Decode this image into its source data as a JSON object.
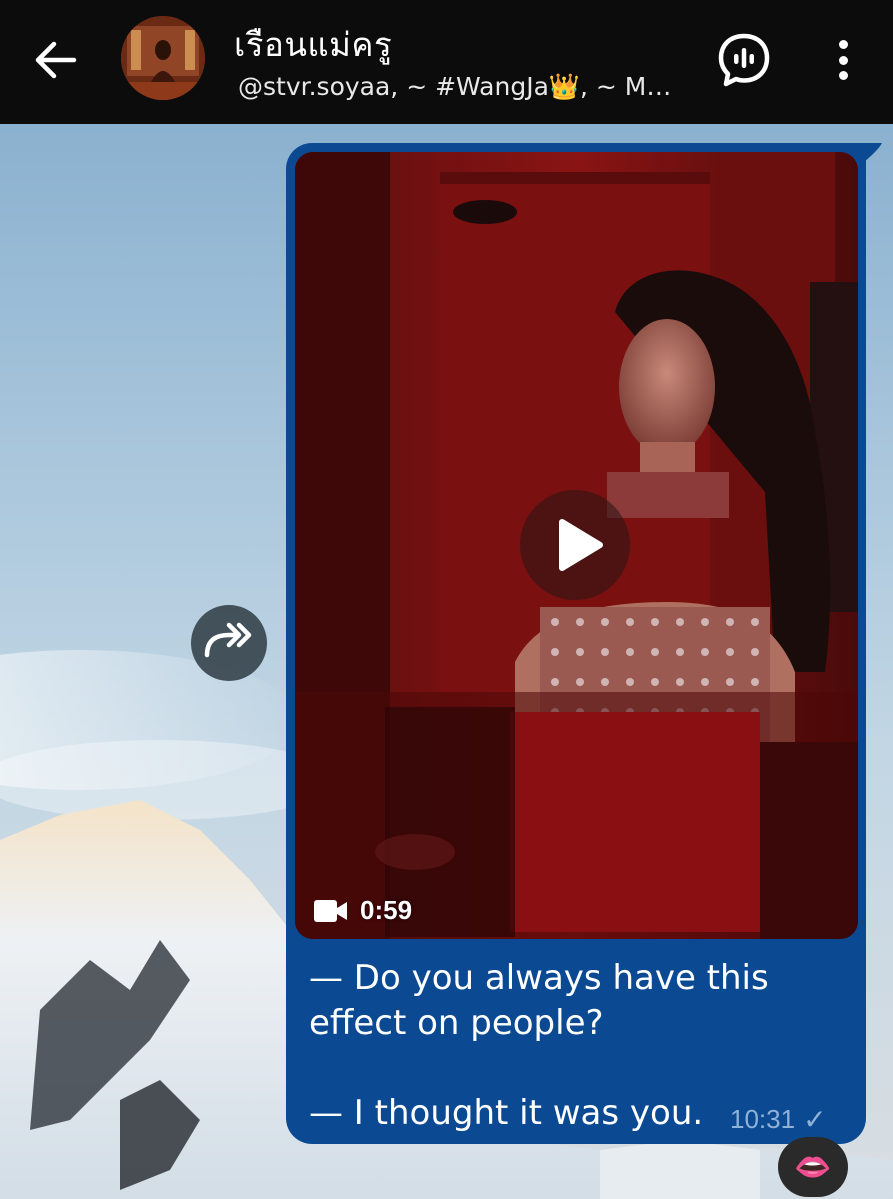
{
  "header": {
    "title": "เรือนแม่ครู",
    "subtitle": "@stvr.soyaa, ~ #WangJa👑, ~ M…",
    "back_icon": "arrow-left-icon",
    "voice_chat_icon": "voice-chat-icon",
    "more_icon": "more-vertical-icon"
  },
  "message": {
    "video_duration": "0:59",
    "video_icon": "video-camera-icon",
    "caption_line1": "— Do you always have this",
    "caption_line2": "effect on people?",
    "caption_line3": "— I thought it was you.",
    "time": "10:31",
    "status": "✓",
    "reaction": "👄",
    "bubble_color": "#0b4a93"
  },
  "share_icon": "forward-icon"
}
